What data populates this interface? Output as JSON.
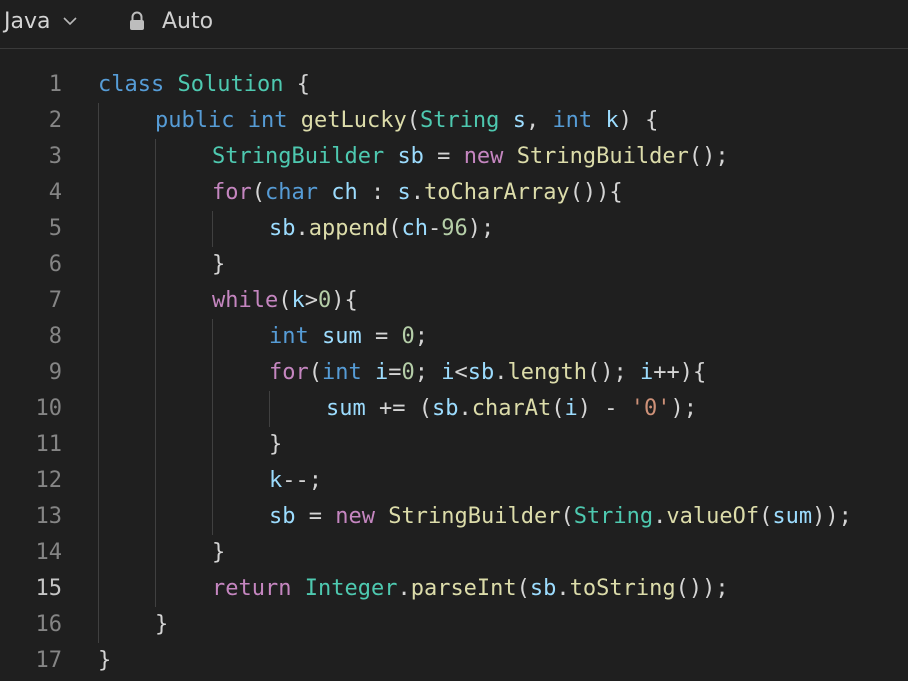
{
  "toolbar": {
    "language_label": "Java",
    "mode_label": "Auto",
    "icons": {
      "language_dropdown": "chevron-down-icon",
      "mode": "lock-icon"
    }
  },
  "editor": {
    "language": "Java",
    "active_line": 15,
    "colors": {
      "background": "#1f1f1f",
      "line_number": "#858585",
      "keyword": "#569cd6",
      "control": "#c586c0",
      "type": "#4ec9b0",
      "function": "#dcdcaa",
      "variable": "#9cdcfe",
      "number": "#b5cea8",
      "string": "#ce9178",
      "plain": "#d4d4d4"
    },
    "lines": [
      {
        "number": "1",
        "indent": 0,
        "tokens": [
          {
            "t": "class",
            "c": "kw"
          },
          {
            "t": " ",
            "c": "pl"
          },
          {
            "t": "Solution",
            "c": "type"
          },
          {
            "t": " {",
            "c": "pl"
          }
        ]
      },
      {
        "number": "2",
        "indent": 1,
        "tokens": [
          {
            "t": "public",
            "c": "kw"
          },
          {
            "t": " ",
            "c": "pl"
          },
          {
            "t": "int",
            "c": "kw"
          },
          {
            "t": " ",
            "c": "pl"
          },
          {
            "t": "getLucky",
            "c": "fn"
          },
          {
            "t": "(",
            "c": "pl"
          },
          {
            "t": "String",
            "c": "type"
          },
          {
            "t": " ",
            "c": "pl"
          },
          {
            "t": "s",
            "c": "var"
          },
          {
            "t": ", ",
            "c": "pl"
          },
          {
            "t": "int",
            "c": "kw"
          },
          {
            "t": " ",
            "c": "pl"
          },
          {
            "t": "k",
            "c": "var"
          },
          {
            "t": ") {",
            "c": "pl"
          }
        ]
      },
      {
        "number": "3",
        "indent": 2,
        "tokens": [
          {
            "t": "StringBuilder",
            "c": "type"
          },
          {
            "t": " ",
            "c": "pl"
          },
          {
            "t": "sb",
            "c": "var"
          },
          {
            "t": " = ",
            "c": "pl"
          },
          {
            "t": "new",
            "c": "ctl"
          },
          {
            "t": " ",
            "c": "pl"
          },
          {
            "t": "StringBuilder",
            "c": "fn"
          },
          {
            "t": "();",
            "c": "pl"
          }
        ]
      },
      {
        "number": "4",
        "indent": 2,
        "tokens": [
          {
            "t": "for",
            "c": "ctl"
          },
          {
            "t": "(",
            "c": "pl"
          },
          {
            "t": "char",
            "c": "kw"
          },
          {
            "t": " ",
            "c": "pl"
          },
          {
            "t": "ch",
            "c": "var"
          },
          {
            "t": " : ",
            "c": "pl"
          },
          {
            "t": "s",
            "c": "var"
          },
          {
            "t": ".",
            "c": "pl"
          },
          {
            "t": "toCharArray",
            "c": "fn"
          },
          {
            "t": "()){",
            "c": "pl"
          }
        ]
      },
      {
        "number": "5",
        "indent": 3,
        "tokens": [
          {
            "t": "sb",
            "c": "var"
          },
          {
            "t": ".",
            "c": "pl"
          },
          {
            "t": "append",
            "c": "fn"
          },
          {
            "t": "(",
            "c": "pl"
          },
          {
            "t": "ch",
            "c": "var"
          },
          {
            "t": "-",
            "c": "pl"
          },
          {
            "t": "96",
            "c": "num"
          },
          {
            "t": ");",
            "c": "pl"
          }
        ]
      },
      {
        "number": "6",
        "indent": 2,
        "tokens": [
          {
            "t": "}",
            "c": "pl"
          }
        ]
      },
      {
        "number": "7",
        "indent": 2,
        "tokens": [
          {
            "t": "while",
            "c": "ctl"
          },
          {
            "t": "(",
            "c": "pl"
          },
          {
            "t": "k",
            "c": "var"
          },
          {
            "t": ">",
            "c": "pl"
          },
          {
            "t": "0",
            "c": "num"
          },
          {
            "t": "){",
            "c": "pl"
          }
        ]
      },
      {
        "number": "8",
        "indent": 3,
        "tokens": [
          {
            "t": "int",
            "c": "kw"
          },
          {
            "t": " ",
            "c": "pl"
          },
          {
            "t": "sum",
            "c": "var"
          },
          {
            "t": " = ",
            "c": "pl"
          },
          {
            "t": "0",
            "c": "num"
          },
          {
            "t": ";",
            "c": "pl"
          }
        ]
      },
      {
        "number": "9",
        "indent": 3,
        "tokens": [
          {
            "t": "for",
            "c": "ctl"
          },
          {
            "t": "(",
            "c": "pl"
          },
          {
            "t": "int",
            "c": "kw"
          },
          {
            "t": " ",
            "c": "pl"
          },
          {
            "t": "i",
            "c": "var"
          },
          {
            "t": "=",
            "c": "pl"
          },
          {
            "t": "0",
            "c": "num"
          },
          {
            "t": "; ",
            "c": "pl"
          },
          {
            "t": "i",
            "c": "var"
          },
          {
            "t": "<",
            "c": "pl"
          },
          {
            "t": "sb",
            "c": "var"
          },
          {
            "t": ".",
            "c": "pl"
          },
          {
            "t": "length",
            "c": "fn"
          },
          {
            "t": "(); ",
            "c": "pl"
          },
          {
            "t": "i",
            "c": "var"
          },
          {
            "t": "++){",
            "c": "pl"
          }
        ]
      },
      {
        "number": "10",
        "indent": 4,
        "tokens": [
          {
            "t": "sum",
            "c": "var"
          },
          {
            "t": " += (",
            "c": "pl"
          },
          {
            "t": "sb",
            "c": "var"
          },
          {
            "t": ".",
            "c": "pl"
          },
          {
            "t": "charAt",
            "c": "fn"
          },
          {
            "t": "(",
            "c": "pl"
          },
          {
            "t": "i",
            "c": "var"
          },
          {
            "t": ") - ",
            "c": "pl"
          },
          {
            "t": "'0'",
            "c": "str"
          },
          {
            "t": ");",
            "c": "pl"
          }
        ]
      },
      {
        "number": "11",
        "indent": 3,
        "tokens": [
          {
            "t": "}",
            "c": "pl"
          }
        ]
      },
      {
        "number": "12",
        "indent": 3,
        "tokens": [
          {
            "t": "k",
            "c": "var"
          },
          {
            "t": "--;",
            "c": "pl"
          }
        ]
      },
      {
        "number": "13",
        "indent": 3,
        "tokens": [
          {
            "t": "sb",
            "c": "var"
          },
          {
            "t": " = ",
            "c": "pl"
          },
          {
            "t": "new",
            "c": "ctl"
          },
          {
            "t": " ",
            "c": "pl"
          },
          {
            "t": "StringBuilder",
            "c": "fn"
          },
          {
            "t": "(",
            "c": "pl"
          },
          {
            "t": "String",
            "c": "type"
          },
          {
            "t": ".",
            "c": "pl"
          },
          {
            "t": "valueOf",
            "c": "fn"
          },
          {
            "t": "(",
            "c": "pl"
          },
          {
            "t": "sum",
            "c": "var"
          },
          {
            "t": "));",
            "c": "pl"
          }
        ]
      },
      {
        "number": "14",
        "indent": 2,
        "tokens": [
          {
            "t": "}",
            "c": "pl"
          }
        ]
      },
      {
        "number": "15",
        "indent": 2,
        "tokens": [
          {
            "t": "return",
            "c": "ctl"
          },
          {
            "t": " ",
            "c": "pl"
          },
          {
            "t": "Integer",
            "c": "type"
          },
          {
            "t": ".",
            "c": "pl"
          },
          {
            "t": "parseInt",
            "c": "fn"
          },
          {
            "t": "(",
            "c": "pl"
          },
          {
            "t": "sb",
            "c": "var"
          },
          {
            "t": ".",
            "c": "pl"
          },
          {
            "t": "toString",
            "c": "fn"
          },
          {
            "t": "());",
            "c": "pl"
          }
        ]
      },
      {
        "number": "16",
        "indent": 1,
        "tokens": [
          {
            "t": "}",
            "c": "pl"
          }
        ]
      },
      {
        "number": "17",
        "indent": 0,
        "tokens": [
          {
            "t": "}",
            "c": "pl"
          }
        ]
      }
    ]
  }
}
